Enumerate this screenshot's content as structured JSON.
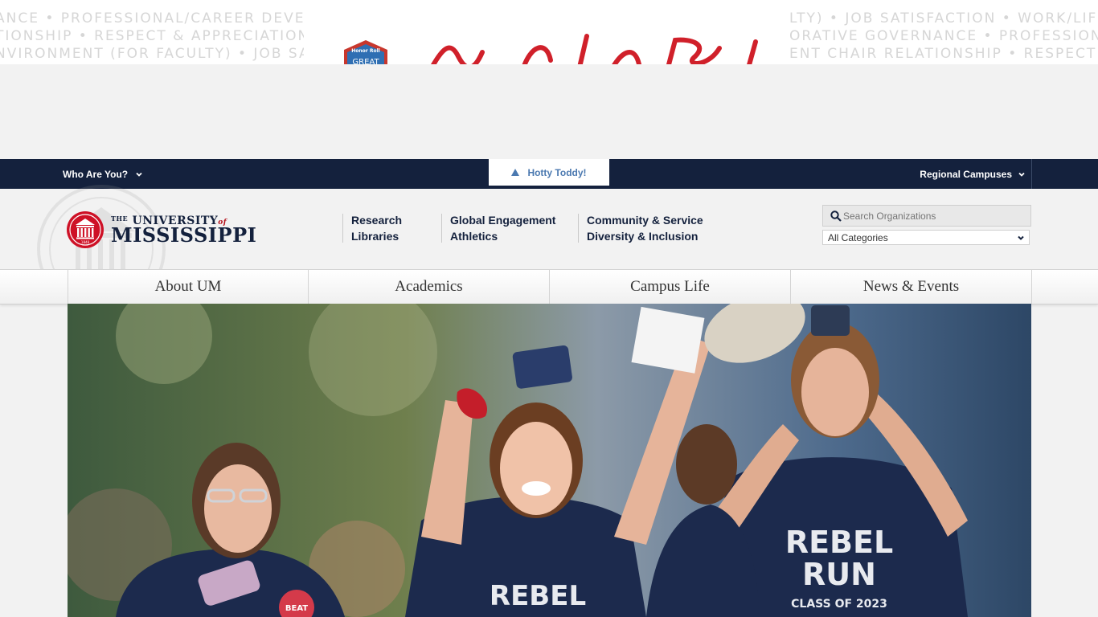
{
  "banner": {
    "ticker_left": [
      "ANCE • PROFESSIONAL/CAREER DEVELO",
      "TIONSHIP • RESPECT & APPRECIATION",
      "NVIRONMENT (FOR FACULTY) • JOB SA"
    ],
    "ticker_right": [
      "LTY) • JOB SATISFACTION • WORK/LIFE",
      "ORATIVE GOVERNANCE • PROFESSIONA",
      "ENT CHAIR RELATIONSHIP • RESPECT &"
    ],
    "badge_text": "Honor Roll",
    "badge_word": "GREAT"
  },
  "utility": {
    "who_label": "Who Are You?",
    "hotty_label": "Hotty Toddy!",
    "regional_label": "Regional Campuses"
  },
  "logo": {
    "the": "THE",
    "university": "UNIVERSITY",
    "of": "of",
    "mississippi": "MISSISSIPPI",
    "year": "1848"
  },
  "quicklinks": {
    "col1": [
      "Research",
      "Libraries"
    ],
    "col2": [
      "Global Engagement",
      "Athletics"
    ],
    "col3": [
      "Community & Service",
      "Diversity & Inclusion"
    ]
  },
  "search": {
    "placeholder": "Search Organizations",
    "category": "All Categories"
  },
  "mainnav": [
    "About UM",
    "Academics",
    "Campus Life",
    "News & Events"
  ],
  "hero": {
    "shirt_line1": "REBEL",
    "shirt_line2": "RUN",
    "shirt_line3": "CLASS OF 2023",
    "button_text": "BEAT"
  },
  "colors": {
    "navy": "#14213d",
    "red": "#ce1126",
    "accent_blue": "#4b79b0"
  }
}
